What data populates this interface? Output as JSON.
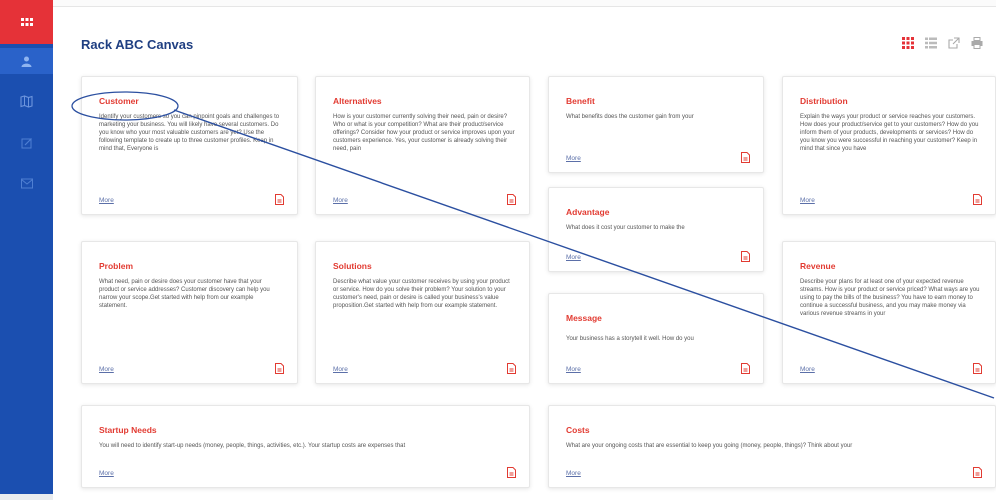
{
  "app": {
    "title": "Rack ABC Canvas"
  },
  "sidebar": {
    "items": [
      {
        "icon": "user-icon"
      },
      {
        "icon": "map-icon"
      },
      {
        "icon": "edit-icon"
      },
      {
        "icon": "mail-icon"
      }
    ]
  },
  "toolbar": {
    "icons": [
      "grid-view-icon",
      "list-view-icon",
      "share-icon",
      "print-icon"
    ]
  },
  "more_label": "More",
  "cards": {
    "customer": {
      "title": "Customer",
      "body": "Identify your customers so you can pinpoint goals and challenges to marketing your business. You will likely have several customers. Do you know who your most valuable customers are yet? Use the following template to create up to three customer profiles. Keep in mind that, Everyone is"
    },
    "alternatives": {
      "title": "Alternatives",
      "body": "How is your customer currently solving their need, pain or desire? Who or what is your competition? What are their product/service offerings? Consider how your product or service improves upon your customers experience. Yes, your customer is already solving their need, pain"
    },
    "benefit": {
      "title": "Benefit",
      "body": "What benefits does the customer gain from your"
    },
    "distribution": {
      "title": "Distribution",
      "body": "Explain the ways your product or service reaches your customers. How does your product/service get to your customers? How do you inform them of your products, developments or services? How do you know you were successful in reaching your customer? Keep in mind that since you have"
    },
    "advantage": {
      "title": "Advantage",
      "body": "What does it cost your customer to make the"
    },
    "problem": {
      "title": "Problem",
      "body": "What need, pain or desire does your customer have that your product or service addresses? Customer discovery can help you narrow your scope.Get started with help from our example statement."
    },
    "solutions": {
      "title": "Solutions",
      "body": "Describe what value your customer receives by using your product or service. How do you solve their problem? Your solution to your customer's need, pain or desire is called your business's value proposition.Get started with help from our example statement."
    },
    "revenue": {
      "title": "Revenue",
      "body": "Describe your plans for at least one of your expected revenue streams. How is your product or service priced? What ways are you using to pay the bills of the business? You have to earn money to continue a successful business, and you may make money via various revenue streams in your"
    },
    "message": {
      "title": "Message",
      "body": "Your business has a storytell it well. How do you"
    },
    "startup": {
      "title": "Startup Needs",
      "body": "You will need to identify start-up needs (money, people, things, activities, etc.). Your startup costs are expenses that"
    },
    "costs": {
      "title": "Costs",
      "body": "What are your ongoing costs that are essential to keep you going (money, people, things)? Think about your"
    }
  },
  "annotation": {
    "color": "#2b4fa0"
  }
}
